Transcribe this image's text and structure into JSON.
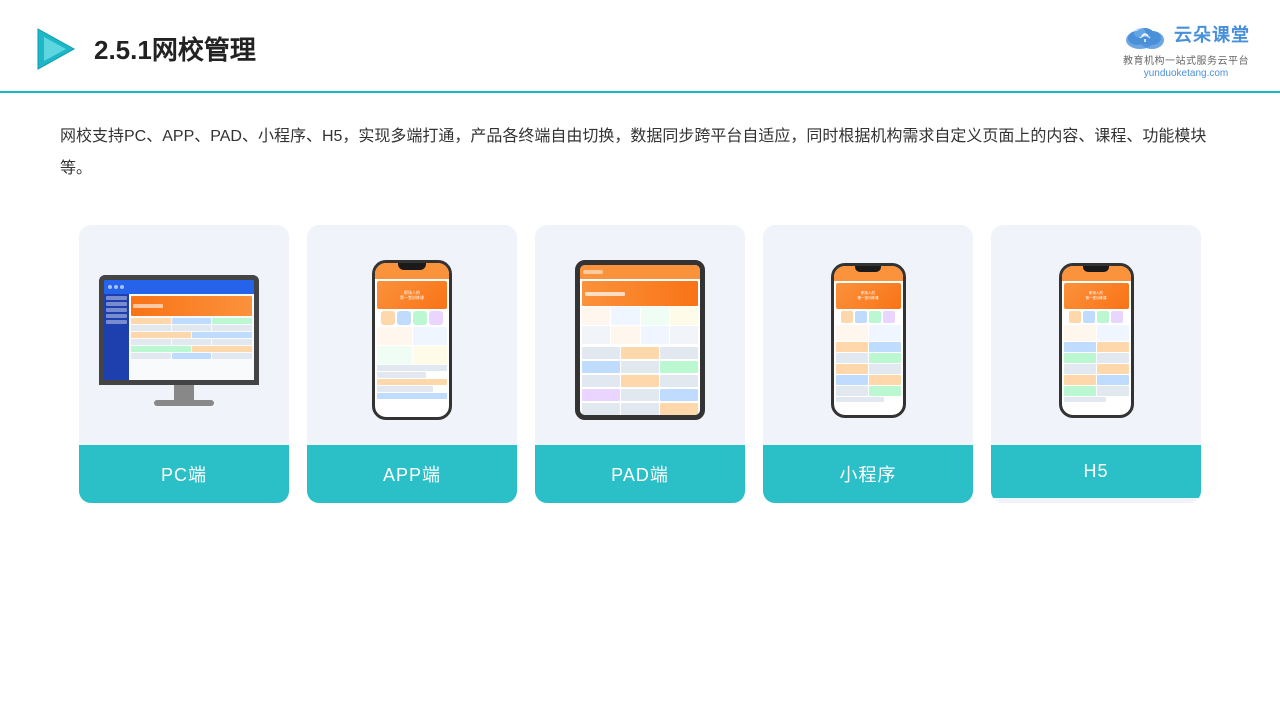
{
  "header": {
    "title": "2.5.1网校管理",
    "logo_main": "云朵课堂",
    "logo_tagline": "教育机构一站\n式服务云平台",
    "logo_url": "yunduoketang.com"
  },
  "description": {
    "text": "网校支持PC、APP、PAD、小程序、H5，实现多端打通，产品各终端自由切换，数据同步跨平台自适应，同时根据机构需求自定义页面上的内容、课程、功能模块等。"
  },
  "cards": [
    {
      "id": "pc",
      "label": "PC端",
      "type": "pc"
    },
    {
      "id": "app",
      "label": "APP端",
      "type": "phone"
    },
    {
      "id": "pad",
      "label": "PAD端",
      "type": "tablet"
    },
    {
      "id": "mini",
      "label": "小程序",
      "type": "phone-mini"
    },
    {
      "id": "h5",
      "label": "H5",
      "type": "phone-mini2"
    }
  ],
  "colors": {
    "accent": "#2bbfc8",
    "header_line": "#1db8c8"
  }
}
